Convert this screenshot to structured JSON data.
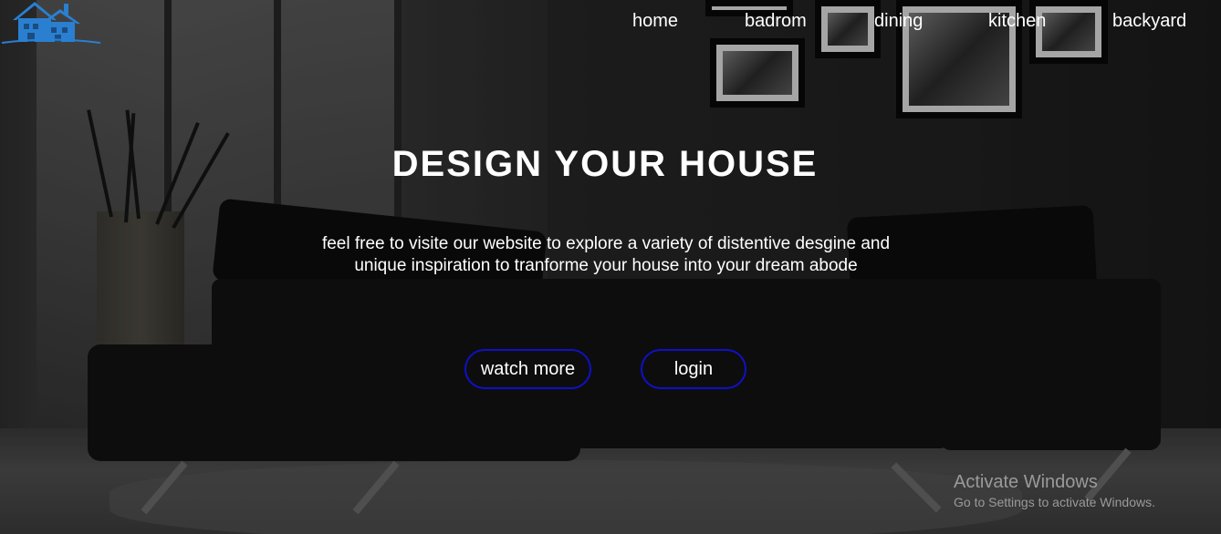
{
  "nav": {
    "items": [
      {
        "label": "home"
      },
      {
        "label": "badrom"
      },
      {
        "label": "dining"
      },
      {
        "label": "kitchen"
      },
      {
        "label": "backyard"
      }
    ]
  },
  "hero": {
    "title": "DESIGN YOUR HOUSE",
    "text_line1": "feel free to visite our website to explore a variety of distentive desgine and",
    "text_line2": "unique inspiration to tranforme your house into your dream abode"
  },
  "buttons": {
    "watch_more": "watch more",
    "login": "login"
  },
  "watermark": {
    "title": "Activate Windows",
    "subtitle": "Go to Settings to activate Windows."
  },
  "colors": {
    "button_border": "#1010c8",
    "logo": "#2a7fd1",
    "text": "#ffffff",
    "watermark": "#9a9a9a"
  },
  "icons": {
    "logo": "house-logo-icon"
  }
}
